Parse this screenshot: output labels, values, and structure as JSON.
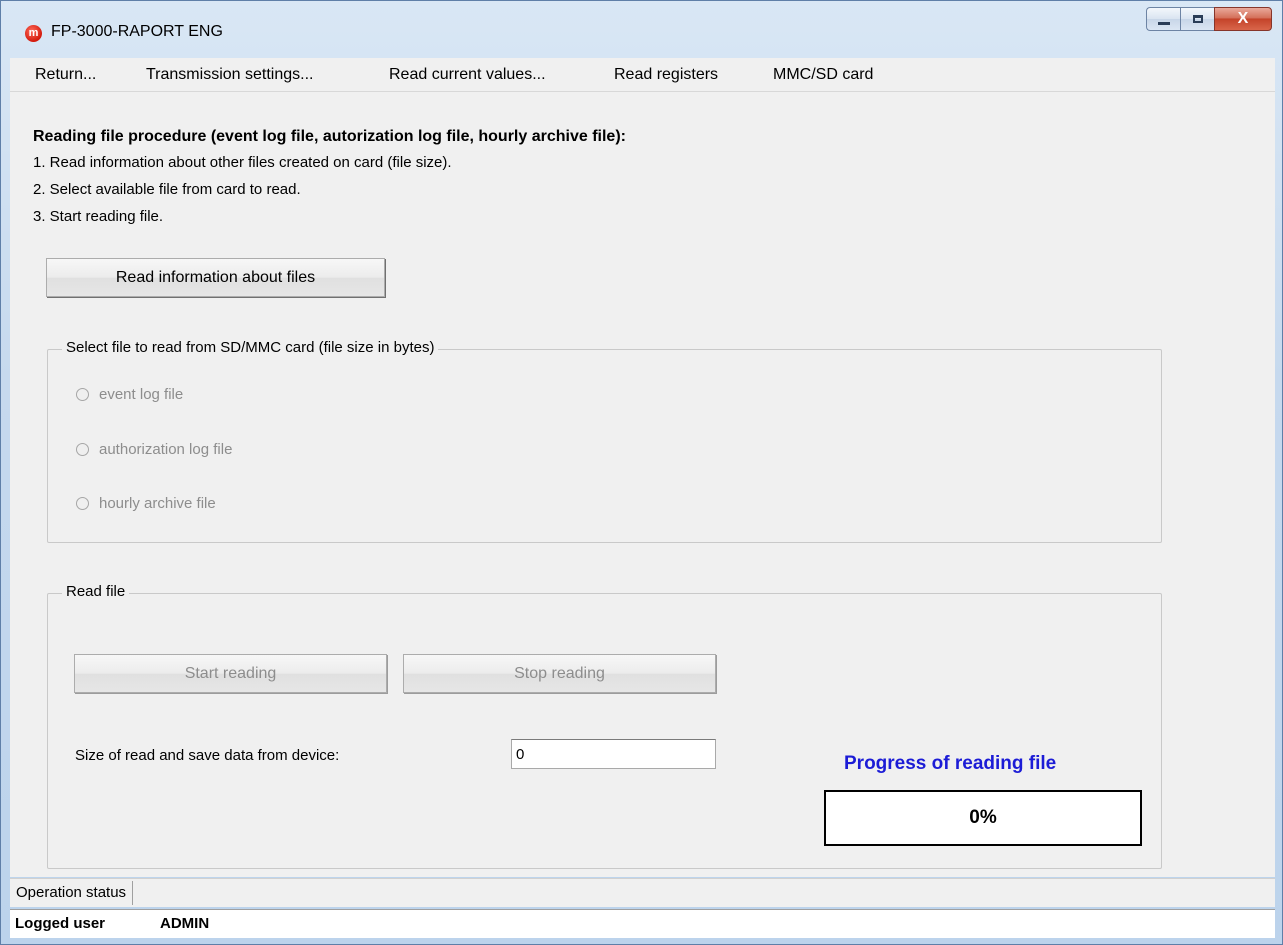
{
  "window": {
    "title": "FP-3000-RAPORT ENG",
    "app_icon_glyph": "m",
    "close_glyph": "X"
  },
  "menu": {
    "items": [
      {
        "label": "Return..."
      },
      {
        "label": "Transmission settings..."
      },
      {
        "label": "Read current values..."
      },
      {
        "label": "Read registers"
      },
      {
        "label": "MMC/SD card"
      }
    ]
  },
  "procedure": {
    "title": "Reading file procedure (event log file, autorization log file, hourly archive file):",
    "steps": [
      "1. Read information about other files created on card (file size).",
      "2. Select available file from card to read.",
      "3. Start reading file."
    ]
  },
  "read_info_button": "Read information about files",
  "select_group": {
    "legend": "Select file to read from SD/MMC card (file size in bytes)",
    "options": [
      {
        "label": "event log file"
      },
      {
        "label": "authorization log file"
      },
      {
        "label": "hourly archive file"
      }
    ]
  },
  "read_group": {
    "legend": "Read file",
    "start_label": "Start reading",
    "stop_label": "Stop reading",
    "size_label": "Size of read and save data from device:",
    "size_value": "0",
    "progress_title": "Progress of reading file",
    "progress_text": "0%"
  },
  "status": {
    "operation_label": "Operation status",
    "logged_user_label": "Logged user",
    "logged_user_value": "ADMIN"
  },
  "colors": {
    "progress_title": "#1c1cd6",
    "close_button": "#c4432a"
  },
  "icons": [
    "app-logo-icon",
    "minimize-icon",
    "maximize-icon",
    "close-icon",
    "radio-icon"
  ]
}
